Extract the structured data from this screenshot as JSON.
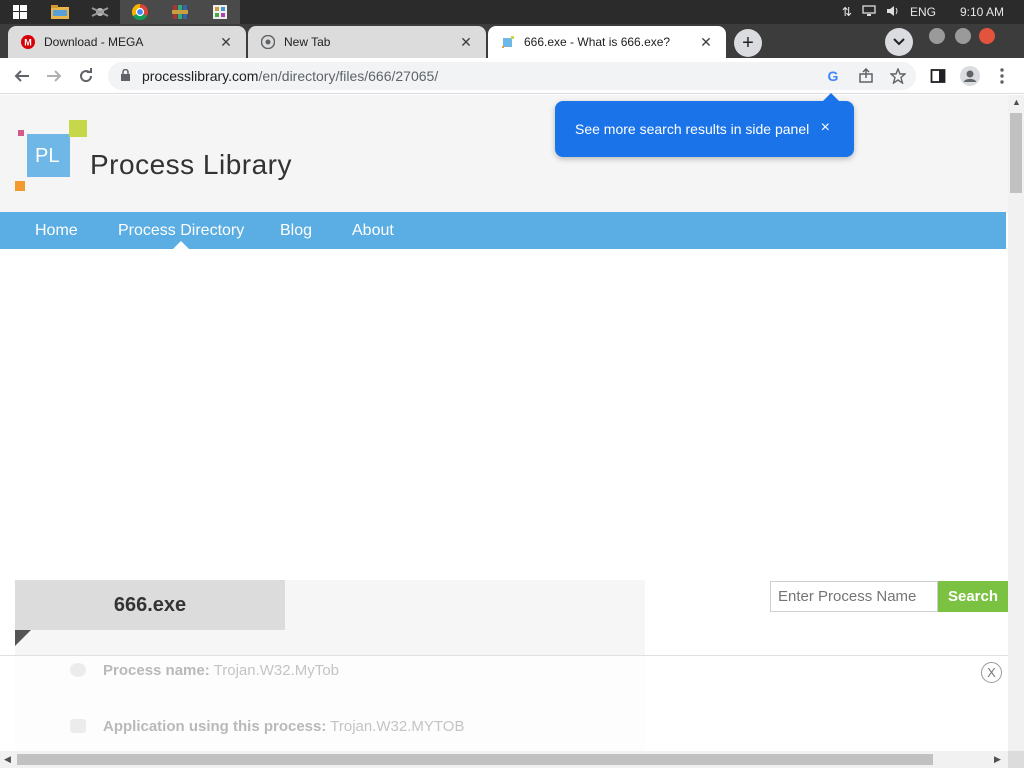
{
  "taskbar": {
    "apps": [
      {
        "name": "windows-start"
      },
      {
        "name": "file-explorer"
      },
      {
        "name": "app-3"
      },
      {
        "name": "chrome"
      },
      {
        "name": "winrar"
      },
      {
        "name": "app-6"
      }
    ],
    "tray": {
      "language": "ENG",
      "time": "9:10 AM"
    }
  },
  "browser": {
    "tabs": [
      {
        "title": "Download - MEGA",
        "icon": "mega-icon"
      },
      {
        "title": "New Tab",
        "icon": "chrome-icon"
      },
      {
        "title": "666.exe - What is 666.exe?",
        "icon": "process-library-icon"
      }
    ],
    "url_host": "processlibrary.com",
    "url_path": "/en/directory/files/666/27065/"
  },
  "toast": {
    "message": "See more search results in side panel",
    "close": "×"
  },
  "site": {
    "logo_text": "PL",
    "title": "Process Library",
    "nav": [
      "Home",
      "Process Directory",
      "Blog",
      "About"
    ]
  },
  "process": {
    "filename": "666.exe",
    "name_label": "Process name:",
    "name_value": "Trojan.W32.MyTob",
    "app_label": "Application using this process:",
    "app_value": "Trojan.W32.MYTOB"
  },
  "search": {
    "placeholder": "Enter Process Name",
    "button": "Search"
  },
  "ad": {
    "close": "X"
  },
  "colors": {
    "nav": "#5aaee3",
    "toast": "#1a73e8",
    "search_button": "#7cc242"
  }
}
